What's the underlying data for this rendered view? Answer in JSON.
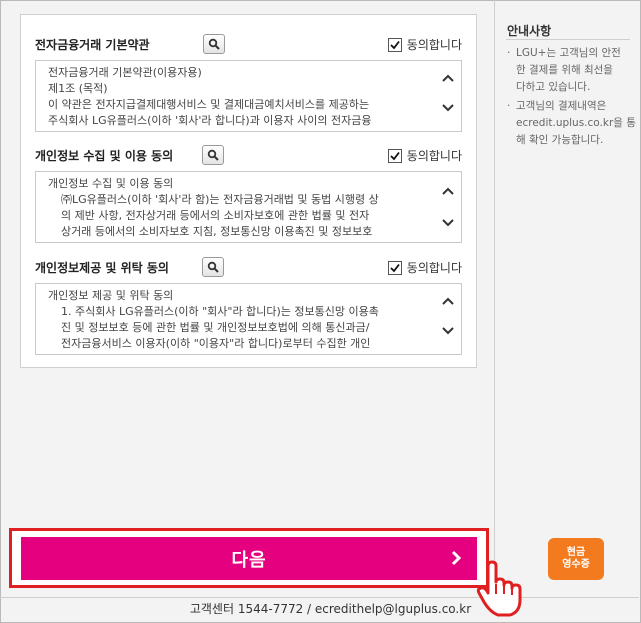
{
  "sections": [
    {
      "title": "전자금융거래 기본약관",
      "agree_label": "동의합니다",
      "agreed": true,
      "lines": [
        "전자금융거래 기본약관(이용자용)",
        "제1조 (목적)",
        "이 약관은 전자지급결제대행서비스 및 결제대금예치서비스를 제공하는",
        "주식회사 LG유플러스(이하 '회사'라 합니다)과 이용자 사이의 전자금융"
      ]
    },
    {
      "title": "개인정보 수집 및 이용 동의",
      "agree_label": "동의합니다",
      "agreed": true,
      "lines": [
        "개인정보 수집 및 이용 동의",
        "㈜LG유플러스(이하 '회사'라 함)는 전자금융거래법 및 동법 시행령 상",
        "의 제반 사항, 전자상거래 등에서의 소비자보호에 관한 법률 및 전자",
        "상거래 등에서의 소비자보호 지침, 정보통신망 이용촉진 및 정보보호"
      ]
    },
    {
      "title": "개인정보제공 및 위탁 동의",
      "agree_label": "동의합니다",
      "agreed": true,
      "lines": [
        "개인정보 제공 및 위탁 동의",
        "1. 주식회사 LG유플러스(이하 \"회사\"라 합니다)는 정보통신망 이용촉",
        "진 및 정보보호 등에 관한 법률 및 개인정보보호법에 의해 통신과금/",
        "전자금융서비스 이용자(이하 \"이용자\"라 합니다)로부터 수집한 개인"
      ]
    }
  ],
  "sidebar": {
    "title": "안내사항",
    "notes": [
      [
        "LGU+는 고객님의 안전",
        "한 결제를 위해 최선을",
        "다하고 있습니다."
      ],
      [
        "고객님의 결제내역은",
        "ecredit.uplus.co.kr을 통",
        "해 확인 가능합니다."
      ]
    ],
    "receipt_badge": [
      "현금",
      "영수증"
    ]
  },
  "next_button_label": "다음",
  "footer_text": "고객센터 1544-7772 / ecredithelp@lguplus.co.kr",
  "colors": {
    "accent": "#e4007f",
    "highlight": "#e02020",
    "receipt": "#f47a1f"
  }
}
